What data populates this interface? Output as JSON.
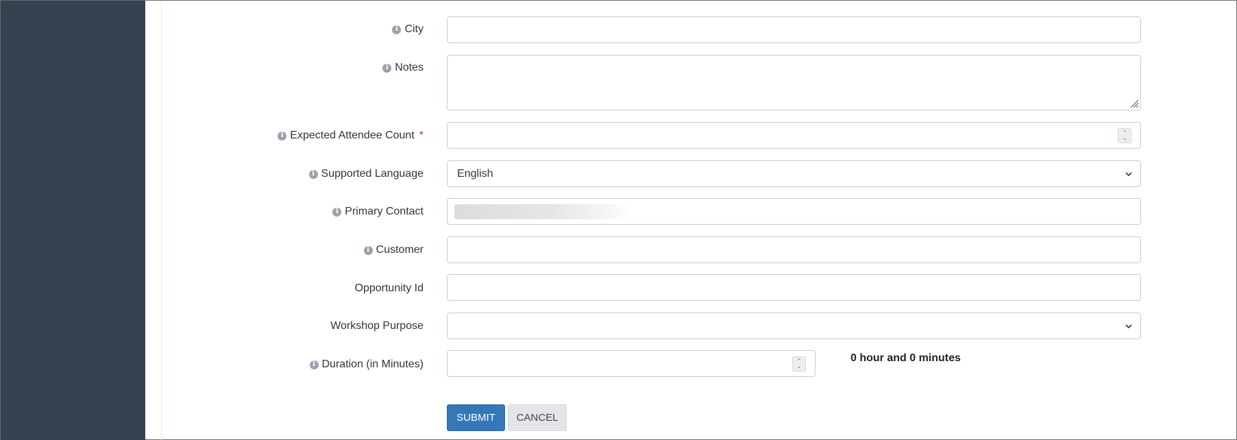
{
  "form": {
    "city": {
      "label": "City",
      "value": ""
    },
    "notes": {
      "label": "Notes",
      "value": ""
    },
    "attendee_count": {
      "label": "Expected Attendee Count",
      "required_mark": "*",
      "value": ""
    },
    "language": {
      "label": "Supported Language",
      "selected": "English"
    },
    "primary_contact": {
      "label": "Primary Contact",
      "value": ""
    },
    "customer": {
      "label": "Customer",
      "value": ""
    },
    "opportunity_id": {
      "label": "Opportunity Id",
      "value": ""
    },
    "workshop_purpose": {
      "label": "Workshop Purpose",
      "selected": ""
    },
    "duration": {
      "label": "Duration (in Minutes)",
      "value": "",
      "summary": "0 hour and 0 minutes"
    }
  },
  "actions": {
    "submit_label": "SUBMIT",
    "cancel_label": "CANCEL"
  },
  "icons": {
    "info": "info-circle-icon",
    "spinner": "number-spinner-icon",
    "dropdown": "chevron-down-icon",
    "resize": "resize-grip-icon"
  },
  "colors": {
    "sidebar": "#35414f",
    "submit": "#3478b7",
    "required": "#c0392b"
  }
}
